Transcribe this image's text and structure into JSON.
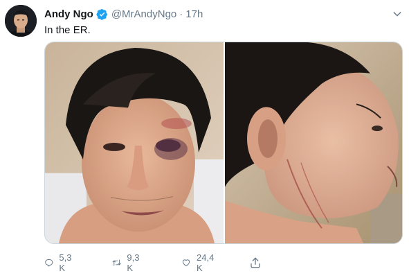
{
  "tweet": {
    "author_name": "Andy Ngo",
    "handle": "@MrAndyNgo",
    "separator": "·",
    "time": "17h",
    "text": "In the ER.",
    "verified": true
  },
  "icons": {
    "avatar": "profile-photo",
    "verified": "verified-badge-icon",
    "caret": "chevron-down-icon",
    "reply": "reply-icon",
    "retweet": "retweet-icon",
    "like": "heart-icon",
    "share": "share-icon"
  },
  "media": {
    "photos": [
      {
        "subject": "injured face, front view"
      },
      {
        "subject": "injured face, side profile"
      }
    ]
  },
  "actions": {
    "replies": "5,3 K",
    "retweets": "9,3 K",
    "likes": "24,4 K"
  },
  "colors": {
    "text": "#14171a",
    "secondary": "#657786",
    "verified": "#1da1f2",
    "border": "#ccd6dd"
  }
}
